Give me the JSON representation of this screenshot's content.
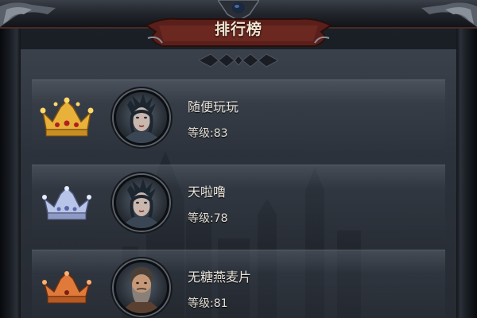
{
  "header": {
    "title": "排行榜"
  },
  "colors": {
    "gold": "#e8b13a",
    "silver": "#b8c4e8",
    "bronze": "#e07a3a",
    "banner": "#5a1f1a"
  },
  "rankings": [
    {
      "rank": 1,
      "crown": "gold-crown-icon",
      "avatar": "elf-sorceress-avatar",
      "name": "随便玩玩",
      "level_label": "等级:83"
    },
    {
      "rank": 2,
      "crown": "silver-crown-icon",
      "avatar": "elf-sorceress-avatar",
      "name": "天啦噜",
      "level_label": "等级:78"
    },
    {
      "rank": 3,
      "crown": "bronze-crown-icon",
      "avatar": "bearded-warrior-avatar",
      "name": "无糖燕麦片",
      "level_label": "等级:81"
    }
  ]
}
